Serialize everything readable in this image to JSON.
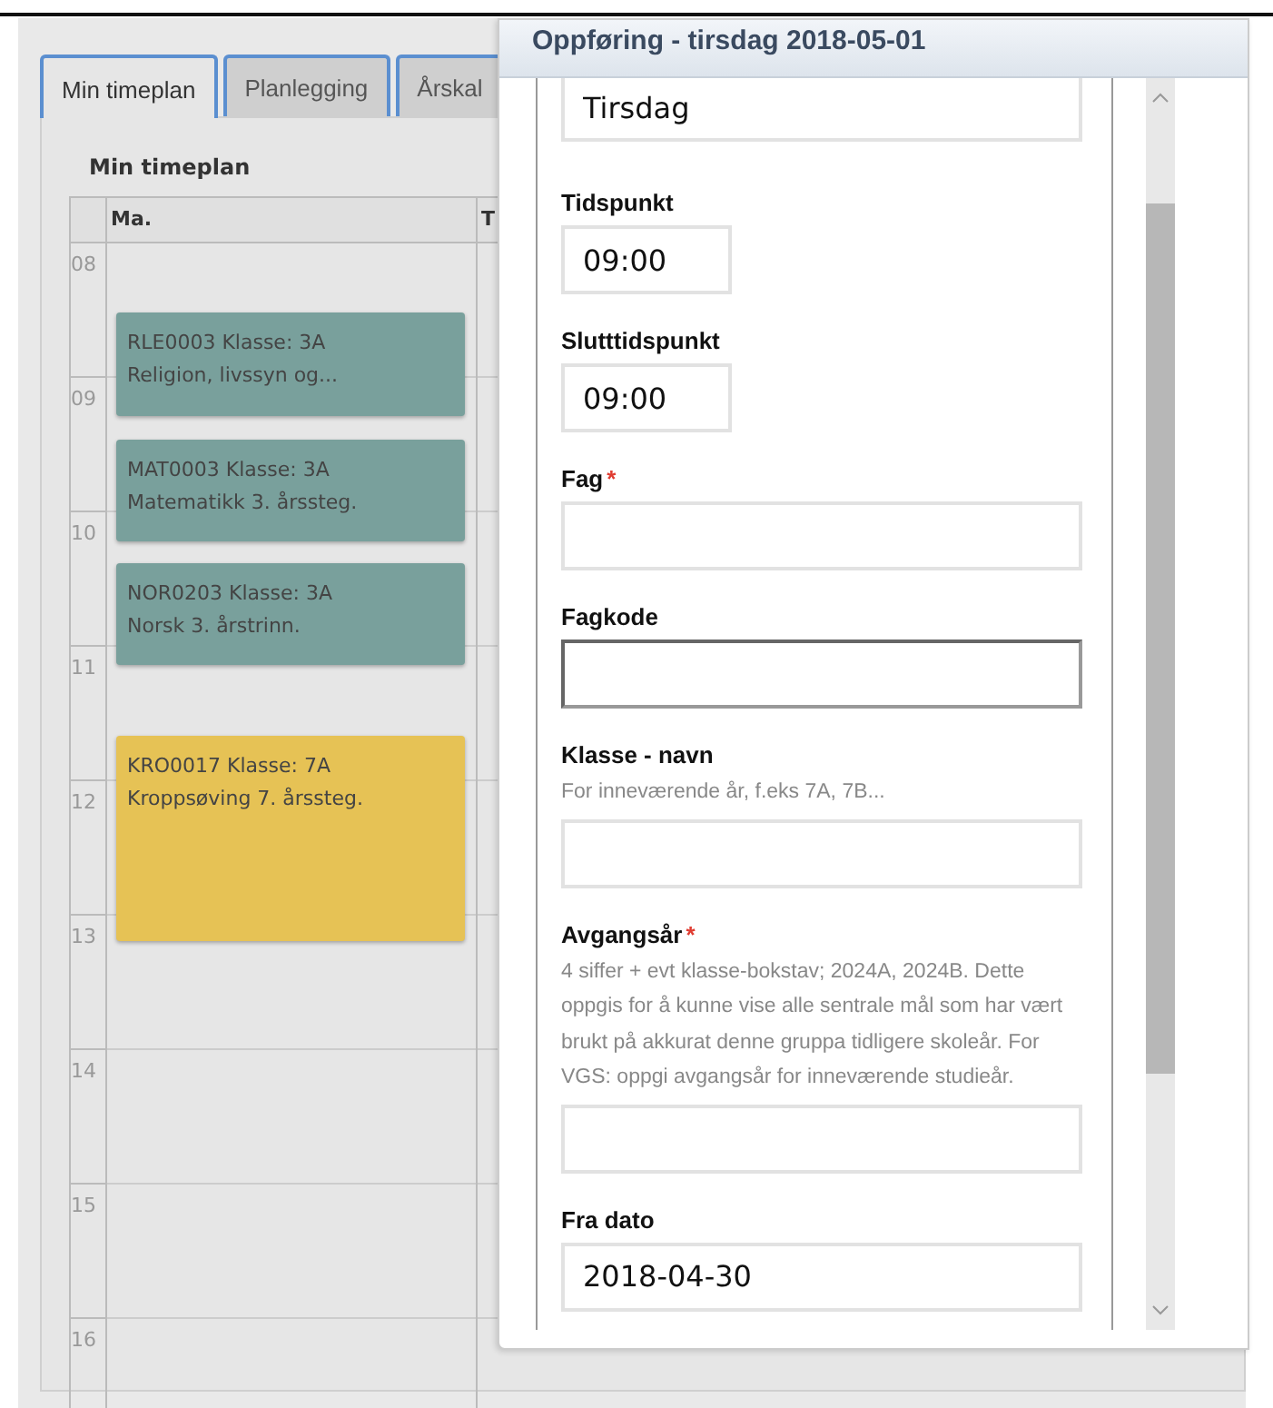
{
  "tabs": [
    {
      "label": "Min timeplan",
      "selected": true
    },
    {
      "label": "Planlegging",
      "selected": false
    },
    {
      "label": "Årskal",
      "selected": false
    }
  ],
  "calendar": {
    "title": "Min timeplan",
    "columns": [
      "Ma.",
      "T"
    ],
    "hours": [
      "08",
      "09",
      "10",
      "11",
      "12",
      "13",
      "14",
      "15",
      "16"
    ],
    "events": [
      {
        "line_1": "RLE0003 Klasse: 3A",
        "line_2": "Religion, livssyn og...",
        "color": "#79a09c"
      },
      {
        "line_1": "MAT0003 Klasse: 3A",
        "line_2": "Matematikk 3. årssteg.",
        "color": "#79a09c"
      },
      {
        "line_1": "NOR0203 Klasse: 3A",
        "line_2": "Norsk 3. årstrinn.",
        "color": "#79a09c"
      },
      {
        "line_1": "KRO0017 Klasse: 7A",
        "line_2": "Kroppsøving 7. årssteg.",
        "color": "#e6c255"
      }
    ]
  },
  "dialog": {
    "title": "Oppføring - tirsdag 2018-05-01",
    "fields": [
      {
        "kind": "text",
        "value": "Tirsdag",
        "focused": false
      },
      {
        "kind": "time",
        "label": "Tidspunkt",
        "value": "09:00",
        "focused": false
      },
      {
        "kind": "time",
        "label": "Slutttidspunkt",
        "value": "09:00",
        "focused": false
      },
      {
        "kind": "text",
        "label": "Fag",
        "required_mark": "*",
        "focused": false
      },
      {
        "kind": "text",
        "label": "Fagkode",
        "focused": true
      },
      {
        "kind": "text",
        "label": "Klasse - navn",
        "help": "For inneværende år, f.eks 7A, 7B...",
        "focused": false
      },
      {
        "kind": "text",
        "label": "Avgangsår",
        "required_mark": "*",
        "help": "4 siffer + evt klasse-bokstav; 2024A, 2024B. Dette oppgis for å kunne vise alle sentrale mål som har vært brukt på akkurat denne gruppa tidligere skoleår. For VGS: oppgi avgangsår for inneværende studieår.",
        "focused": false
      },
      {
        "kind": "text",
        "label": "Fra dato",
        "value": "2018-04-30",
        "focused": false
      }
    ]
  }
}
